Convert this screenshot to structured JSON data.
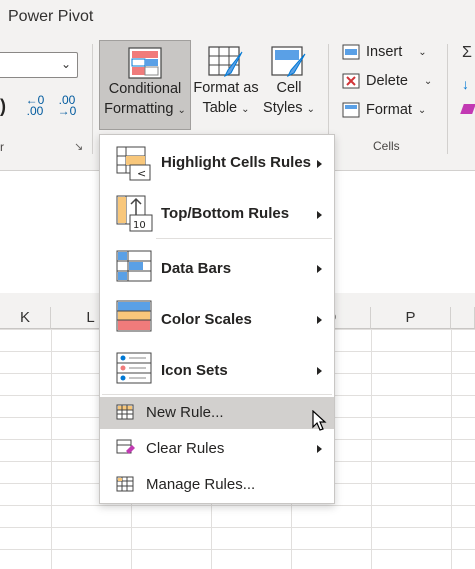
{
  "ribbon": {
    "tab_title": "Power Pivot",
    "number_group_label": "r",
    "increase_decimal": "←0\n.00",
    "decrease_decimal": ".00\n→0",
    "conditional_formatting": {
      "line1": "Conditional",
      "line2": "Formatting"
    },
    "format_as_table": {
      "line1": "Format as",
      "line2": "Table"
    },
    "cell_styles": {
      "line1": "Cell",
      "line2": "Styles"
    },
    "cells_group": {
      "insert": "Insert",
      "delete": "Delete",
      "format": "Format",
      "label": "Cells"
    }
  },
  "columns": [
    {
      "letter": "K"
    },
    {
      "letter": "L"
    },
    {
      "letter": "O"
    },
    {
      "letter": "P"
    }
  ],
  "menu": {
    "items": [
      {
        "label": "Highlight Cells Rules",
        "icon": "highlight-cells-rules-icon",
        "submenu": true
      },
      {
        "label": "Top/Bottom Rules",
        "icon": "top-bottom-rules-icon",
        "submenu": true
      },
      {
        "label": "Data Bars",
        "icon": "data-bars-icon",
        "submenu": true
      },
      {
        "label": "Color Scales",
        "icon": "color-scales-icon",
        "submenu": true
      },
      {
        "label": "Icon Sets",
        "icon": "icon-sets-icon",
        "submenu": true
      },
      {
        "label": "New Rule...",
        "icon": "new-rule-icon",
        "submenu": false
      },
      {
        "label": "Clear Rules",
        "icon": "clear-rules-icon",
        "submenu": true
      },
      {
        "label": "Manage Rules...",
        "icon": "manage-rules-icon",
        "submenu": false
      }
    ]
  },
  "colors": {
    "accent": "#0078d4",
    "red_fill": "#f07b7b",
    "orange_fill": "#f8c77b",
    "hover": "#d2d0ce"
  }
}
